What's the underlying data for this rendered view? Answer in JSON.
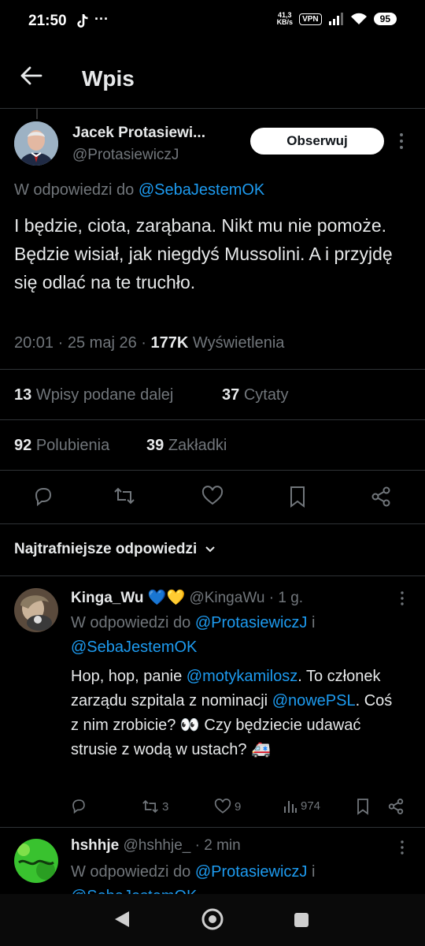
{
  "status_bar": {
    "time": "21:50",
    "dots": "···",
    "speed_value": "41,3",
    "speed_unit": "KB/s",
    "vpn": "VPN",
    "battery": "95"
  },
  "header": {
    "title": "Wpis"
  },
  "tweet": {
    "display_name": "Jacek Protasiewi...",
    "handle": "@ProtasiewiczJ",
    "follow_label": "Obserwuj",
    "reply_prefix": "W odpowiedzi do",
    "reply_handle": "@SebaJestemOK",
    "text": "I będzie, ciota, zarąbana. Nikt mu nie pomoże. Będzie wisiał, jak niegdyś Mussolini. A i przyjdę się odlać  na te truchło.",
    "time": "20:01",
    "date": "25 maj 26",
    "views_count": "177K",
    "views_label": "Wyświetlenia",
    "sep": "·",
    "reposts_count": "13",
    "reposts_label": "Wpisy podane dalej",
    "quotes_count": "37",
    "quotes_label": "Cytaty",
    "likes_count": "92",
    "likes_label": "Polubienia",
    "bookmarks_count": "39",
    "bookmarks_label": "Zakładki"
  },
  "replies_section": {
    "title": "Najtrafniejsze odpowiedzi"
  },
  "replies": [
    {
      "display_name": "Kinga_Wu",
      "emoji": "💙💛",
      "handle": "@KingaWu",
      "time": "1 g.",
      "reply_prefix": "W odpowiedzi do",
      "reply_handle_1": "@ProtasiewiczJ",
      "reply_and": "i",
      "reply_handle_2": "@SebaJestemOK",
      "text_1": "Hop, hop, panie ",
      "mention_1": "@motykamilosz",
      "text_2": ". To członek zarządu szpitala z nominacji ",
      "mention_2": "@nowePSL",
      "text_3": ". Coś z nim zrobicie? 👀 Czy będziecie udawać strusie z wodą w ustach? 🚑",
      "reposts": "3",
      "likes": "9",
      "views": "974"
    },
    {
      "display_name": "hshhje",
      "handle": "@hshhje_",
      "time": "2 min",
      "reply_prefix": "W odpowiedzi do",
      "reply_handle_1": "@ProtasiewiczJ",
      "reply_and": "i",
      "reply_handle_2": "@SebaJestemOK"
    }
  ],
  "colors": {
    "background": "#000000",
    "link": "#1d9bf0",
    "secondary_text": "#71767b",
    "divider": "#2f3336"
  }
}
